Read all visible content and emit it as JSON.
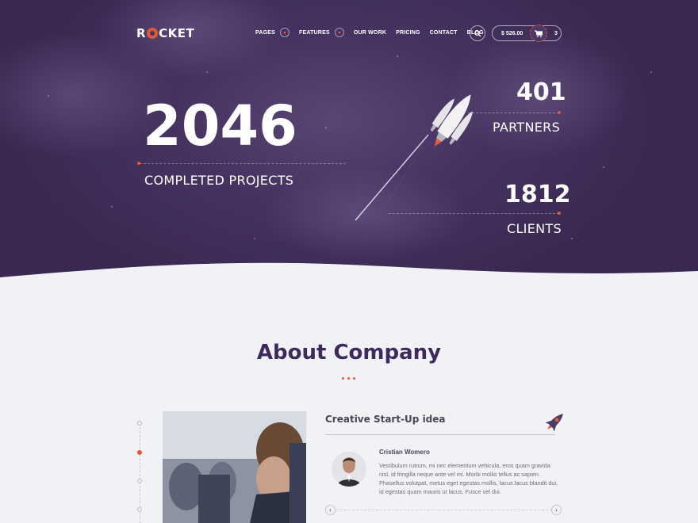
{
  "brand": {
    "logo_text_left": "R",
    "logo_text_right": "CKET"
  },
  "nav": {
    "items": [
      {
        "label": "PAGES",
        "dropdown": true
      },
      {
        "label": "FEATURES",
        "dropdown": true
      },
      {
        "label": "OUR WORK",
        "dropdown": false
      },
      {
        "label": "PRICING",
        "dropdown": false
      },
      {
        "label": "CONTACT",
        "dropdown": false
      },
      {
        "label": "BLOG",
        "dropdown": false
      }
    ],
    "search_icon": "search-icon",
    "cart": {
      "price": "$ 526.00",
      "count": "3",
      "icon": "cart-icon"
    }
  },
  "hero": {
    "stats": {
      "projects": {
        "value": "2046",
        "label": "COMPLETED PROJECTS"
      },
      "partners": {
        "value": "401",
        "label": "PARTNERS"
      },
      "clients": {
        "value": "1812",
        "label": "CLIENTS"
      }
    }
  },
  "about": {
    "title": "About Company",
    "card": {
      "title": "Creative Start-Up idea",
      "author": "Cristian Womero",
      "text": "Vestibulum rutrum, mi nec elementum vehicula, eros quam gravida nisl, id fringilla neque ante vel mi. Morbi mollis tellus ac sapien. Phasellus volutpat, metus eget egestas mollis, lacus lacus blandit dui, id egestas quam mauris ut lacus. Fusce vel dui."
    },
    "arrows": {
      "prev": "‹",
      "next": "›"
    }
  },
  "colors": {
    "accent": "#e2583a",
    "hero_bg": "#463361",
    "title": "#3e2a5d",
    "page_bg": "#f1f2f5"
  }
}
